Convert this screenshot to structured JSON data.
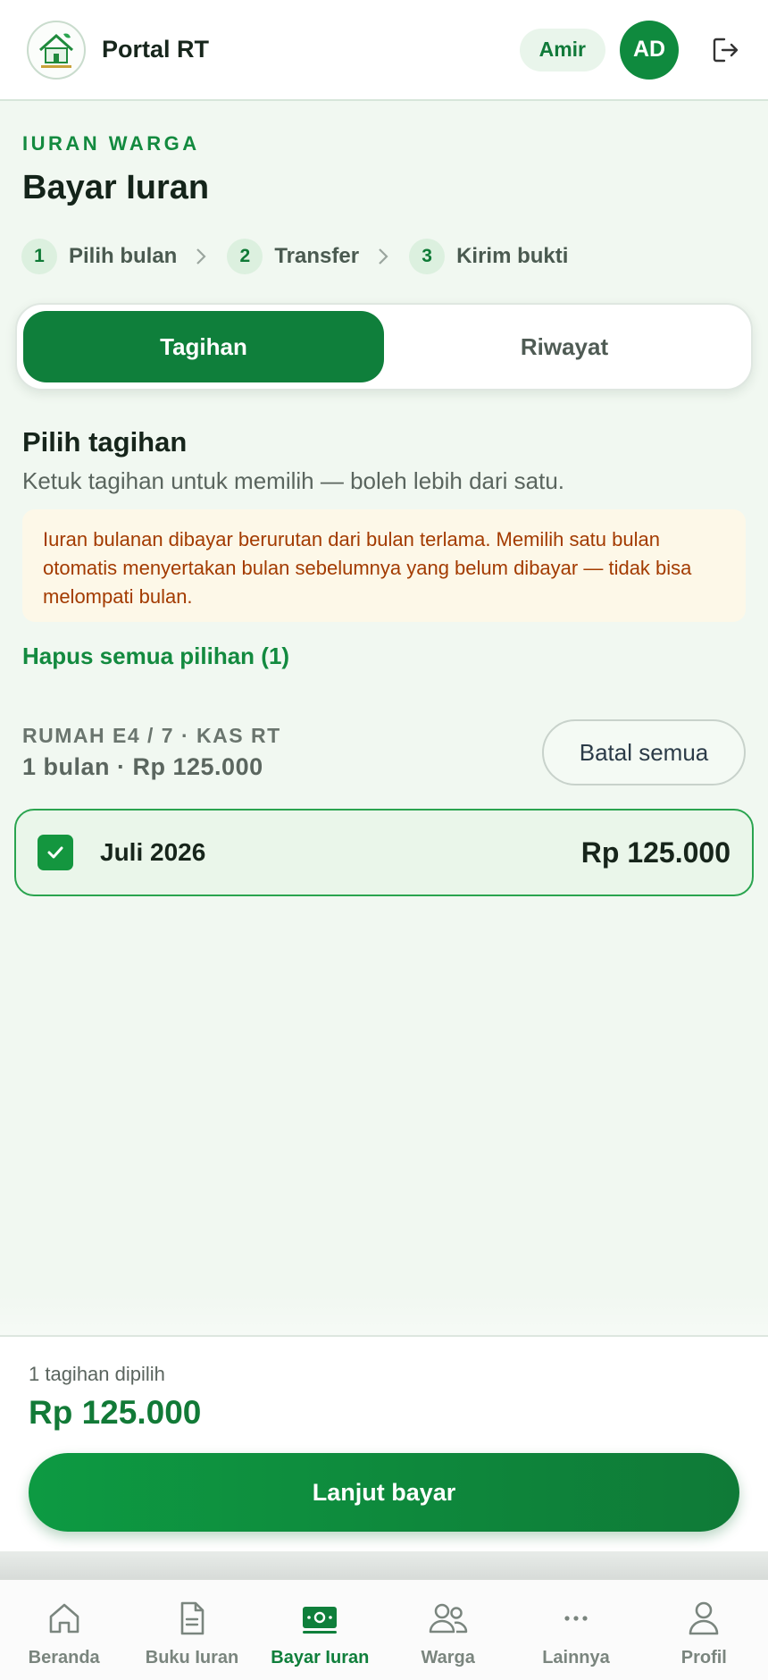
{
  "header": {
    "app_title": "Portal RT",
    "user_name": "Amir",
    "avatar_initials": "AD",
    "logo_icon": "house-logo-icon",
    "logout_icon": "logout-icon"
  },
  "page": {
    "eyebrow": "IURAN WARGA",
    "title": "Bayar Iuran"
  },
  "steps": [
    {
      "num": "1",
      "label": "Pilih bulan"
    },
    {
      "num": "2",
      "label": "Transfer"
    },
    {
      "num": "3",
      "label": "Kirim bukti"
    }
  ],
  "tabs": [
    {
      "label": "Tagihan",
      "active": true
    },
    {
      "label": "Riwayat",
      "active": false
    }
  ],
  "section": {
    "title": "Pilih tagihan",
    "subtitle": "Ketuk tagihan untuk memilih — boleh lebih dari satu."
  },
  "notice": "Iuran bulanan dibayar berurutan dari bulan terlama. Memilih satu bulan otomatis menyertakan bulan sebelumnya yang belum dibayar — tidak bisa melompati bulan.",
  "clear_selection": "Hapus semua pilihan (1)",
  "group": {
    "label": "RUMAH E4 / 7 · KAS RT",
    "summary": "1 bulan · Rp 125.000",
    "cancel_all": "Batal semua",
    "bills": [
      {
        "month": "Juli 2026",
        "amount": "Rp 125.000",
        "checked": true
      }
    ]
  },
  "footer": {
    "count": "1 tagihan dipilih",
    "total": "Rp 125.000",
    "pay_button": "Lanjut bayar"
  },
  "nav": [
    {
      "label": "Beranda",
      "icon": "home-icon",
      "active": false
    },
    {
      "label": "Buku Iuran",
      "icon": "document-icon",
      "active": false
    },
    {
      "label": "Bayar Iuran",
      "icon": "money-icon",
      "active": true
    },
    {
      "label": "Warga",
      "icon": "users-icon",
      "active": false
    },
    {
      "label": "Lainnya",
      "icon": "more-icon",
      "active": false
    },
    {
      "label": "Profil",
      "icon": "profile-icon",
      "active": false
    }
  ],
  "colors": {
    "primary": "#0f7f3b",
    "accent_text": "#138a3f",
    "notice_bg": "#fdf8e8",
    "notice_text": "#a33b00",
    "page_bg": "#f1f8f1"
  }
}
